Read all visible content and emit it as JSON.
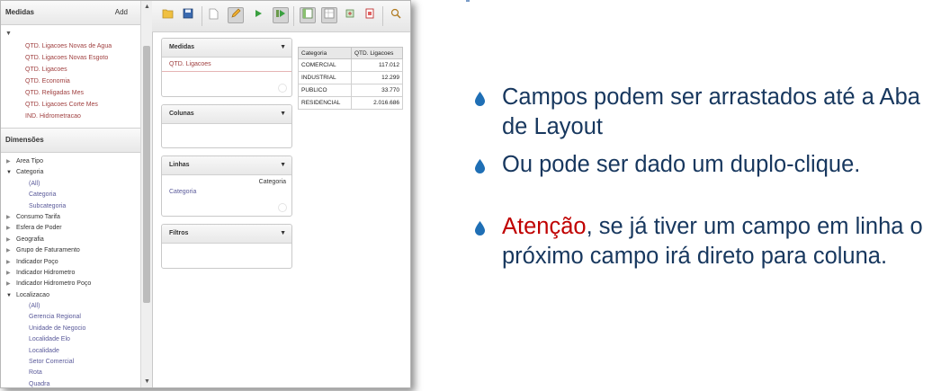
{
  "sidebar": {
    "measures_title": "Medidas",
    "add_label": "Add",
    "measures": [
      "QTD. Ligacoes Novas de Agua",
      "QTD. Ligacoes Novas Esgoto",
      "QTD. Ligacoes",
      "QTD. Economia",
      "QTD. Religadas Mes",
      "QTD. Ligacoes Corte Mes",
      "IND. Hidrometracao"
    ],
    "dimensions_title": "Dimensões",
    "dimensions": [
      {
        "label": "Area Tipo",
        "expanded": false
      },
      {
        "label": "Categoria",
        "expanded": true,
        "children": [
          "(All)",
          "Categoria",
          "Subcategoria"
        ]
      },
      {
        "label": "Consumo Tarifa",
        "expanded": false
      },
      {
        "label": "Esfera de Poder",
        "expanded": false
      },
      {
        "label": "Geografia",
        "expanded": false
      },
      {
        "label": "Grupo de Faturamento",
        "expanded": false
      },
      {
        "label": "Indicador Poço",
        "expanded": false
      },
      {
        "label": "Indicador Hidrometro",
        "expanded": false
      },
      {
        "label": "Indicador Hidrometro Poço",
        "expanded": false
      },
      {
        "label": "Localizacao",
        "expanded": true,
        "children": [
          "(All)",
          "Gerencia Regional",
          "Unidade de Negocio",
          "Localidade Elo",
          "Localidade",
          "Setor Comercial",
          "Rota",
          "Quadra"
        ]
      }
    ]
  },
  "toolbar": {
    "buttons": [
      "open-icon",
      "save-icon",
      "new-icon",
      "edit-icon",
      "run-icon",
      "run-all-icon",
      "layout-icon",
      "table-icon",
      "export-icon",
      "pdf-icon",
      "search-icon"
    ]
  },
  "layout": {
    "measures_box": {
      "title": "Medidas",
      "item": "QTD. Ligacoes"
    },
    "columns_box": {
      "title": "Colunas"
    },
    "rows_box": {
      "title": "Linhas",
      "header": "Categoria",
      "item": "Categoria"
    },
    "filters_box": {
      "title": "Filtros"
    }
  },
  "result": {
    "headers": [
      "Categoria",
      "QTD. Ligacoes"
    ],
    "rows": [
      [
        "COMERCIAL",
        "117.012"
      ],
      [
        "INDUSTRIAL",
        "12.299"
      ],
      [
        "PUBLICO",
        "33.770"
      ],
      [
        "RESIDENCIAL",
        "2.016.686"
      ]
    ]
  },
  "slide": {
    "bullet1": "Campos podem ser arrastados até a Aba de Layout",
    "bullet2": "Ou pode ser dado um duplo-clique.",
    "bullet3_highlight": "Atenção",
    "bullet3_rest": ", se já tiver um campo em linha o próximo campo irá direto para coluna.",
    "bullet_color": "#1f6fb5",
    "text_color": "#17375e",
    "highlight_color": "#c00000"
  }
}
